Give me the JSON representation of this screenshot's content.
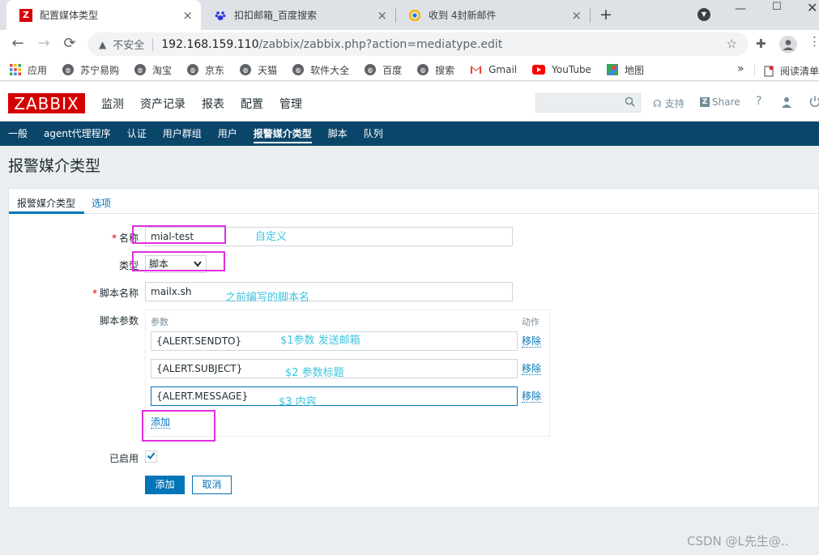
{
  "browser": {
    "tabs": [
      {
        "title": "配置媒体类型",
        "active": true,
        "favicon": "zabbix-icon"
      },
      {
        "title": "扣扣邮箱_百度搜索",
        "active": false,
        "favicon": "baidu-paw-icon"
      },
      {
        "title": "收到 4封新邮件",
        "active": false,
        "favicon": "mail-icon"
      }
    ],
    "new_tab": "+",
    "close": "×",
    "insecure_label": "不安全",
    "url_host": "192.168.159.110",
    "url_path": "/zabbix/zabbix.php?action=mediatype.edit",
    "bookmarks": [
      {
        "label": "应用",
        "icon": "apps-grid-icon"
      },
      {
        "label": "苏宁易购",
        "icon": "globe-icon"
      },
      {
        "label": "淘宝",
        "icon": "globe-icon"
      },
      {
        "label": "京东",
        "icon": "globe-icon"
      },
      {
        "label": "天猫",
        "icon": "globe-icon"
      },
      {
        "label": "软件大全",
        "icon": "globe-icon"
      },
      {
        "label": "百度",
        "icon": "globe-icon"
      },
      {
        "label": "搜索",
        "icon": "globe-icon"
      },
      {
        "label": "Gmail",
        "icon": "gmail-icon"
      },
      {
        "label": "YouTube",
        "icon": "youtube-icon"
      },
      {
        "label": "地图",
        "icon": "maps-icon"
      }
    ],
    "bookmarks_more": "»",
    "reading_list": "阅读清单"
  },
  "zabbix": {
    "logo": "ZABBIX",
    "main_menu": [
      "监测",
      "资产记录",
      "报表",
      "配置",
      "管理"
    ],
    "active_main": "管理",
    "support": "支持",
    "share": "Share",
    "help": "?",
    "sub_menu": [
      "一般",
      "agent代理程序",
      "认证",
      "用户群组",
      "用户",
      "报警媒介类型",
      "脚本",
      "队列"
    ],
    "active_sub": "报警媒介类型",
    "page_title": "报警媒介类型"
  },
  "form": {
    "tabs": [
      "报警媒介类型",
      "选项"
    ],
    "name_label": "名称",
    "name_value": "mial-test",
    "type_label": "类型",
    "type_value": "脚本",
    "script_name_label": "脚本名称",
    "script_name_value": "mailx.sh",
    "params_label": "脚本参数",
    "params_header": "参数",
    "action_header": "动作",
    "params": [
      "{ALERT.SENDTO}",
      "{ALERT.SUBJECT}",
      "{ALERT.MESSAGE}"
    ],
    "remove_label": "移除",
    "add_link": "添加",
    "enabled_label": "已启用",
    "enabled": true,
    "submit_button": "添加",
    "cancel_button": "取消"
  },
  "annotations": {
    "name_note": "自定义",
    "script_note": "之前编写的脚本名",
    "param1_note": "$1参数 发送邮箱",
    "param2_note": "$2 参数标题",
    "param3_note": "$3 内容"
  },
  "watermark": "CSDN @L先生@..",
  "colors": {
    "zabbix_red": "#d40000",
    "subnav_bg": "#0a466a",
    "link_blue": "#0275b8",
    "annotation_box": "#e02ee0",
    "annotation_text": "#3cc4e0"
  }
}
